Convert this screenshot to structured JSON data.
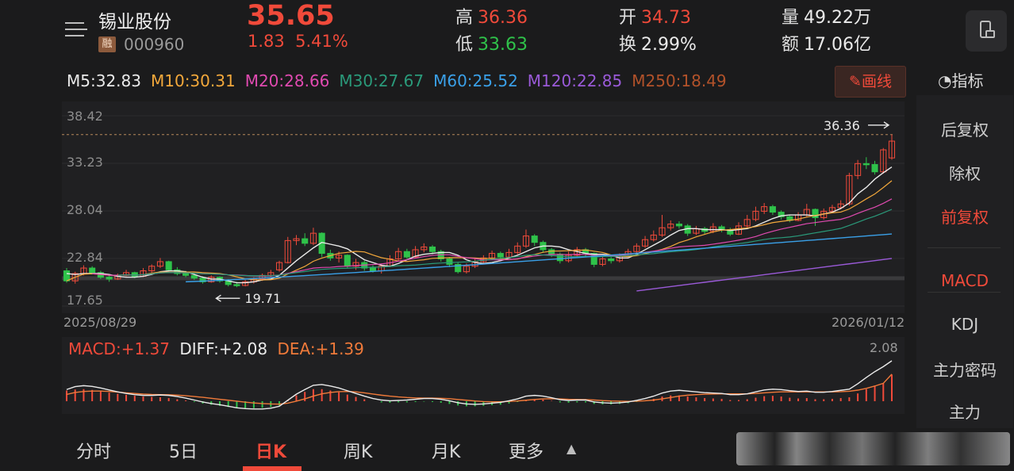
{
  "header": {
    "stock_name": "锡业股份",
    "margin_badge": "融",
    "stock_code": "000960",
    "price": "35.65",
    "change": "1.83",
    "change_pct": "5.41%",
    "high_label": "高",
    "high_value": "36.36",
    "low_label": "低",
    "low_value": "33.63",
    "open_label": "开",
    "open_value": "34.73",
    "turnover_label": "换",
    "turnover_value": "2.99%",
    "volume_label": "量",
    "volume_value": "49.22万",
    "amount_label": "额",
    "amount_value": "17.06亿",
    "device_icon": "phone-landscape-icon"
  },
  "ma_legend": [
    {
      "text": "M5:32.83",
      "color": "#eaeaea"
    },
    {
      "text": "M10:30.31",
      "color": "#f3a83b"
    },
    {
      "text": "M20:28.66",
      "color": "#e04ab0"
    },
    {
      "text": "M30:27.67",
      "color": "#2a9a7a"
    },
    {
      "text": "M60:25.52",
      "color": "#3aa0e8"
    },
    {
      "text": "M120:22.85",
      "color": "#9a5ad8"
    },
    {
      "text": "M250:18.49",
      "color": "#b2522a"
    }
  ],
  "draw_button": "✎画线",
  "indicator_button": "指标",
  "side_items": [
    {
      "label": "后复权",
      "active": false
    },
    {
      "label": "除权",
      "active": false
    },
    {
      "label": "前复权",
      "active": true
    },
    {
      "label": "MACD",
      "active": true
    },
    {
      "label": "KDJ",
      "active": false
    },
    {
      "label": "主力密码",
      "active": false
    },
    {
      "label": "主力",
      "active": false
    }
  ],
  "chart_data": {
    "type": "candlestick",
    "y_ticks": [
      "38.42",
      "33.23",
      "28.04",
      "22.84",
      "17.65"
    ],
    "ylim": [
      17.65,
      38.42
    ],
    "date_start": "2025/08/29",
    "date_end": "2026/01/12",
    "max_label": "36.36",
    "min_label": "19.71",
    "candles": [
      [
        21.5,
        20.4,
        21.8,
        20.2
      ],
      [
        20.4,
        21.2,
        21.4,
        20.1
      ],
      [
        21.2,
        21.8,
        22.1,
        21.0
      ],
      [
        21.8,
        21.3,
        22.0,
        21.1
      ],
      [
        21.3,
        20.8,
        21.5,
        20.6
      ],
      [
        20.8,
        20.6,
        21.0,
        20.3
      ],
      [
        20.6,
        21.0,
        21.2,
        20.5
      ],
      [
        21.0,
        21.3,
        21.6,
        20.9
      ],
      [
        21.3,
        20.9,
        21.4,
        20.7
      ],
      [
        20.9,
        21.5,
        21.8,
        20.8
      ],
      [
        21.5,
        22.0,
        22.2,
        21.3
      ],
      [
        22.0,
        22.5,
        22.9,
        21.8
      ],
      [
        22.5,
        21.6,
        22.6,
        21.4
      ],
      [
        21.6,
        21.2,
        21.9,
        21.0
      ],
      [
        21.2,
        21.0,
        21.5,
        20.8
      ],
      [
        21.0,
        20.7,
        21.2,
        20.5
      ],
      [
        20.7,
        20.3,
        20.9,
        20.1
      ],
      [
        20.3,
        20.8,
        21.0,
        20.2
      ],
      [
        20.8,
        20.4,
        20.9,
        20.2
      ],
      [
        20.4,
        20.0,
        20.6,
        19.8
      ],
      [
        20.0,
        19.9,
        20.3,
        19.71
      ],
      [
        19.9,
        20.3,
        20.5,
        19.8
      ],
      [
        20.3,
        20.6,
        20.8,
        20.1
      ],
      [
        20.6,
        21.0,
        21.2,
        20.4
      ],
      [
        21.0,
        21.3,
        21.6,
        20.8
      ],
      [
        21.6,
        22.4,
        22.6,
        21.4
      ],
      [
        22.4,
        24.8,
        25.2,
        22.3
      ],
      [
        24.8,
        25.0,
        25.4,
        24.3
      ],
      [
        25.0,
        24.5,
        25.6,
        24.2
      ],
      [
        24.5,
        25.6,
        26.2,
        24.3
      ],
      [
        25.6,
        23.4,
        25.7,
        23.0
      ],
      [
        23.4,
        22.9,
        23.8,
        22.6
      ],
      [
        22.9,
        23.2,
        23.6,
        22.4
      ],
      [
        23.2,
        22.0,
        23.3,
        21.8
      ],
      [
        22.0,
        22.4,
        22.8,
        21.6
      ],
      [
        22.4,
        21.8,
        22.6,
        21.5
      ],
      [
        21.8,
        21.5,
        22.1,
        21.3
      ],
      [
        21.5,
        22.0,
        22.3,
        21.2
      ],
      [
        22.0,
        22.8,
        23.2,
        21.9
      ],
      [
        22.8,
        23.6,
        24.0,
        22.6
      ],
      [
        23.6,
        23.0,
        23.9,
        22.8
      ],
      [
        23.0,
        23.8,
        24.2,
        22.9
      ],
      [
        23.8,
        24.1,
        24.5,
        23.5
      ],
      [
        24.1,
        23.6,
        24.3,
        23.3
      ],
      [
        23.6,
        22.8,
        23.8,
        22.5
      ],
      [
        22.8,
        22.2,
        23.0,
        21.9
      ],
      [
        22.2,
        21.4,
        22.4,
        21.2
      ],
      [
        21.4,
        22.0,
        22.3,
        21.2
      ],
      [
        22.0,
        22.5,
        22.8,
        21.8
      ],
      [
        22.5,
        22.9,
        23.2,
        22.3
      ],
      [
        22.9,
        23.4,
        23.7,
        22.7
      ],
      [
        23.4,
        23.0,
        23.6,
        22.7
      ],
      [
        23.0,
        23.5,
        23.9,
        22.9
      ],
      [
        23.5,
        24.2,
        24.6,
        23.3
      ],
      [
        24.2,
        25.3,
        26.0,
        24.0
      ],
      [
        25.3,
        24.6,
        25.5,
        24.2
      ],
      [
        24.6,
        23.8,
        24.8,
        23.5
      ],
      [
        23.8,
        23.3,
        24.0,
        23.0
      ],
      [
        23.3,
        22.6,
        23.5,
        22.3
      ],
      [
        22.6,
        23.2,
        23.6,
        22.4
      ],
      [
        23.2,
        23.8,
        24.1,
        23.0
      ],
      [
        23.8,
        23.4,
        24.0,
        23.1
      ],
      [
        23.4,
        22.2,
        23.5,
        21.9
      ],
      [
        22.2,
        22.8,
        23.1,
        22.0
      ],
      [
        22.8,
        22.6,
        23.0,
        22.3
      ],
      [
        22.6,
        23.1,
        23.4,
        22.4
      ],
      [
        23.1,
        23.6,
        23.9,
        23.0
      ],
      [
        23.6,
        24.2,
        24.5,
        23.4
      ],
      [
        24.2,
        24.9,
        25.3,
        24.0
      ],
      [
        24.9,
        25.4,
        25.9,
        24.7
      ],
      [
        25.4,
        26.2,
        27.6,
        25.2
      ],
      [
        26.2,
        26.6,
        27.0,
        25.9
      ],
      [
        26.6,
        26.4,
        26.9,
        26.1
      ],
      [
        26.4,
        25.6,
        26.6,
        25.3
      ],
      [
        25.6,
        26.1,
        26.4,
        25.4
      ],
      [
        26.1,
        25.8,
        26.3,
        25.5
      ],
      [
        25.8,
        26.3,
        26.7,
        25.6
      ],
      [
        26.3,
        26.0,
        26.5,
        25.7
      ],
      [
        26.0,
        25.5,
        26.2,
        25.3
      ],
      [
        25.5,
        26.4,
        26.8,
        25.4
      ],
      [
        26.4,
        27.1,
        27.6,
        26.2
      ],
      [
        27.1,
        28.0,
        28.5,
        26.9
      ],
      [
        28.0,
        28.5,
        28.9,
        27.7
      ],
      [
        28.5,
        27.9,
        28.7,
        27.6
      ],
      [
        27.9,
        27.4,
        28.1,
        27.1
      ],
      [
        27.4,
        27.0,
        27.6,
        26.8
      ],
      [
        27.0,
        27.6,
        27.9,
        26.9
      ],
      [
        27.6,
        28.2,
        28.8,
        27.4
      ],
      [
        28.2,
        27.3,
        28.3,
        26.4
      ],
      [
        27.3,
        28.0,
        28.3,
        27.1
      ],
      [
        28.0,
        28.4,
        28.7,
        27.8
      ],
      [
        28.4,
        28.8,
        29.2,
        28.2
      ],
      [
        28.8,
        31.9,
        32.2,
        28.6
      ],
      [
        31.9,
        33.2,
        33.6,
        31.5
      ],
      [
        33.2,
        33.1,
        33.9,
        32.6
      ],
      [
        33.1,
        32.3,
        33.5,
        32.0
      ],
      [
        32.3,
        34.7,
        34.9,
        32.1
      ],
      [
        33.82,
        35.65,
        36.36,
        33.63
      ]
    ],
    "ma_series": {
      "M5": [
        21.2,
        21.1,
        21.2,
        21.2,
        21.2,
        21.1,
        20.9,
        20.8,
        20.8,
        20.9,
        21.1,
        21.4,
        21.5,
        21.5,
        21.4,
        21.1,
        20.8,
        20.6,
        20.6,
        20.4,
        20.2,
        20.2,
        20.3,
        20.5,
        20.6,
        21.0,
        21.8,
        22.6,
        23.3,
        24.0,
        24.6,
        24.4,
        24.2,
        23.9,
        23.3,
        22.7,
        22.4,
        22.1,
        22.0,
        22.3,
        22.7,
        23.1,
        23.3,
        23.4,
        23.5,
        23.5,
        23.2,
        22.7,
        22.4,
        22.3,
        22.4,
        22.6,
        22.9,
        23.2,
        23.6,
        24.0,
        24.2,
        24.2,
        24.1,
        23.8,
        23.6,
        23.4,
        23.3,
        23.3,
        23.2,
        22.9,
        22.9,
        23.3,
        23.8,
        24.3,
        24.8,
        25.4,
        25.9,
        26.1,
        26.1,
        26.0,
        26.0,
        26.0,
        25.9,
        26.0,
        26.1,
        26.4,
        26.8,
        27.2,
        27.5,
        27.6,
        27.6,
        27.6,
        27.5,
        27.7,
        27.9,
        28.3,
        28.9,
        29.9,
        30.6,
        31.5,
        32.2,
        32.83
      ]
    },
    "macd_label": "MACD:+1.37",
    "diff_label": "DIFF:+2.08",
    "dea_label": "DEA:+1.39",
    "macd_max_label": "2.08",
    "macd_values": [
      0.55,
      0.6,
      0.62,
      0.58,
      0.52,
      0.44,
      0.38,
      0.33,
      0.28,
      0.24,
      0.22,
      0.2,
      0.16,
      0.1,
      0.04,
      -0.04,
      -0.12,
      -0.18,
      -0.24,
      -0.3,
      -0.34,
      -0.36,
      -0.36,
      -0.34,
      -0.3,
      -0.22,
      0.05,
      0.3,
      0.48,
      0.62,
      0.62,
      0.55,
      0.46,
      0.34,
      0.22,
      0.1,
      0.0,
      -0.06,
      -0.08,
      -0.06,
      -0.06,
      -0.04,
      -0.02,
      -0.04,
      -0.08,
      -0.14,
      -0.22,
      -0.26,
      -0.26,
      -0.24,
      -0.2,
      -0.18,
      -0.12,
      -0.04,
      0.06,
      0.1,
      0.08,
      0.02,
      -0.06,
      -0.08,
      -0.06,
      -0.06,
      -0.14,
      -0.16,
      -0.16,
      -0.14,
      -0.1,
      -0.04,
      0.04,
      0.12,
      0.24,
      0.3,
      0.3,
      0.24,
      0.2,
      0.16,
      0.14,
      0.12,
      0.06,
      0.06,
      0.1,
      0.18,
      0.26,
      0.28,
      0.24,
      0.18,
      0.14,
      0.16,
      0.1,
      0.1,
      0.12,
      0.16,
      0.2,
      0.4,
      0.62,
      0.8,
      0.92,
      1.37
    ],
    "diff_values": [
      0.6,
      0.75,
      0.8,
      0.76,
      0.68,
      0.58,
      0.48,
      0.4,
      0.34,
      0.3,
      0.3,
      0.32,
      0.3,
      0.24,
      0.16,
      0.06,
      -0.04,
      -0.12,
      -0.18,
      -0.26,
      -0.34,
      -0.38,
      -0.4,
      -0.4,
      -0.36,
      -0.26,
      0.05,
      0.36,
      0.6,
      0.82,
      0.86,
      0.78,
      0.68,
      0.54,
      0.4,
      0.26,
      0.14,
      0.06,
      0.02,
      0.04,
      0.06,
      0.1,
      0.14,
      0.14,
      0.1,
      0.02,
      -0.08,
      -0.14,
      -0.16,
      -0.14,
      -0.1,
      -0.06,
      0.02,
      0.12,
      0.26,
      0.3,
      0.26,
      0.18,
      0.08,
      0.04,
      0.06,
      0.06,
      -0.04,
      -0.08,
      -0.1,
      -0.08,
      -0.04,
      0.04,
      0.14,
      0.26,
      0.42,
      0.52,
      0.56,
      0.52,
      0.48,
      0.44,
      0.42,
      0.4,
      0.34,
      0.34,
      0.38,
      0.48,
      0.58,
      0.62,
      0.6,
      0.54,
      0.5,
      0.52,
      0.46,
      0.46,
      0.5,
      0.56,
      0.62,
      0.9,
      1.22,
      1.52,
      1.78,
      2.08
    ],
    "dea_values": [
      0.35,
      0.45,
      0.5,
      0.52,
      0.52,
      0.5,
      0.47,
      0.43,
      0.4,
      0.37,
      0.35,
      0.34,
      0.33,
      0.31,
      0.28,
      0.24,
      0.2,
      0.15,
      0.1,
      0.05,
      0.0,
      -0.05,
      -0.09,
      -0.12,
      -0.14,
      -0.15,
      -0.1,
      0.0,
      0.12,
      0.26,
      0.38,
      0.45,
      0.49,
      0.5,
      0.48,
      0.43,
      0.37,
      0.31,
      0.26,
      0.22,
      0.19,
      0.17,
      0.16,
      0.16,
      0.15,
      0.13,
      0.09,
      0.05,
      0.01,
      -0.02,
      -0.03,
      -0.03,
      -0.01,
      0.01,
      0.05,
      0.09,
      0.12,
      0.13,
      0.12,
      0.1,
      0.09,
      0.08,
      0.06,
      0.03,
      0.01,
      0.0,
      -0.01,
      0.0,
      0.02,
      0.06,
      0.12,
      0.19,
      0.26,
      0.31,
      0.34,
      0.36,
      0.37,
      0.38,
      0.38,
      0.38,
      0.38,
      0.4,
      0.43,
      0.46,
      0.48,
      0.48,
      0.48,
      0.48,
      0.48,
      0.48,
      0.48,
      0.49,
      0.51,
      0.57,
      0.66,
      0.78,
      0.92,
      1.39
    ]
  },
  "bottom_tabs": [
    {
      "label": "分时",
      "active": false
    },
    {
      "label": "5日",
      "active": false
    },
    {
      "label": "日K",
      "active": true
    },
    {
      "label": "周K",
      "active": false
    },
    {
      "label": "月K",
      "active": false
    },
    {
      "label": "更多",
      "active": false
    }
  ]
}
